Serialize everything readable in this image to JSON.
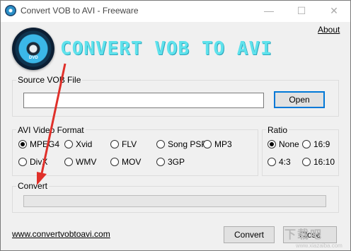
{
  "window": {
    "title": "Convert VOB to AVI - Freeware",
    "minimize": "—",
    "maximize": "☐",
    "close": "✕"
  },
  "header": {
    "about": "About",
    "logo_text": "CONVERT VOB TO AVI",
    "disc_label": "DVD"
  },
  "source": {
    "label": "Source VOB File",
    "value": "",
    "open_button": "Open"
  },
  "format": {
    "label": "AVI Video Format",
    "options": [
      "MPEG4",
      "Xvid",
      "FLV",
      "Song PSP",
      "MP3",
      "DivX",
      "WMV",
      "MOV",
      "3GP"
    ],
    "selected": "MPEG4"
  },
  "ratio": {
    "label": "Ratio",
    "options": [
      "None",
      "16:9",
      "4:3",
      "16:10"
    ],
    "selected": "None"
  },
  "convert": {
    "label": "Convert",
    "progress": 0
  },
  "footer": {
    "link": "www.convertvobtoavi.com",
    "convert_button": "Convert",
    "close_button": "Close"
  },
  "watermark": {
    "text": "下载吧",
    "url": "www.xiazaiba.com"
  },
  "colors": {
    "logo": "#5fe2ec",
    "focus_border": "#0078d7",
    "annotation_arrow": "#e0302a"
  }
}
